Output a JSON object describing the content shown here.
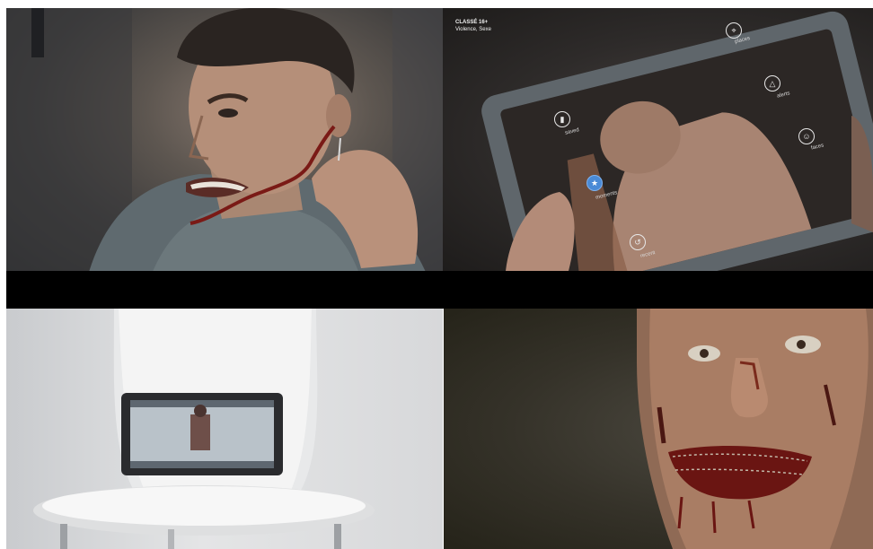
{
  "panel_tablet": {
    "rating_title": "CLASSÉ 16+",
    "rating_subtitle": "Violence, Sexe",
    "menu": [
      {
        "label": "places",
        "icon": "map-pin-icon"
      },
      {
        "label": "alerts",
        "icon": "warning-icon"
      },
      {
        "label": "faces",
        "icon": "face-icon"
      },
      {
        "label": "saved",
        "icon": "save-icon"
      },
      {
        "label": "moments",
        "icon": "star-icon",
        "active": true
      },
      {
        "label": "recent",
        "icon": "history-icon"
      }
    ]
  },
  "colors": {
    "menu_active": "#4a8ad6",
    "letterbox": "#000000"
  }
}
